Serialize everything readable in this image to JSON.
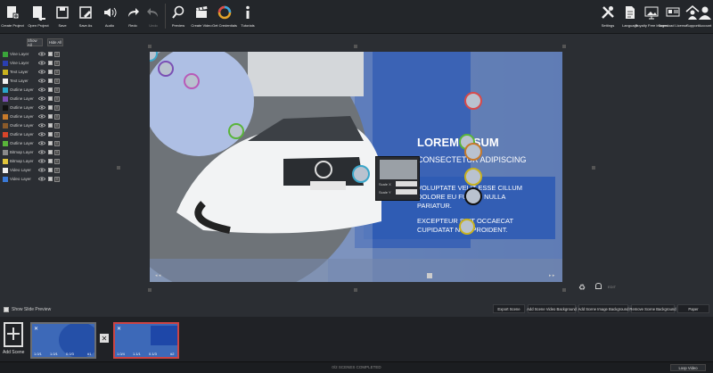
{
  "toolbar": {
    "left": [
      {
        "label": "Create Project",
        "icon": "create-project-icon"
      },
      {
        "label": "Open Project",
        "icon": "open-project-icon"
      },
      {
        "label": "Save",
        "icon": "save-icon"
      },
      {
        "label": "Save As",
        "icon": "save-as-icon"
      },
      {
        "label": "Audio",
        "icon": "audio-icon"
      },
      {
        "label": "Redo",
        "icon": "redo-icon"
      },
      {
        "label": "Undo",
        "icon": "undo-icon"
      },
      {
        "label": "Preview",
        "icon": "preview-icon"
      },
      {
        "label": "Create Video",
        "icon": "create-video-icon"
      },
      {
        "label": "Get Credentials",
        "icon": "credentials-icon"
      },
      {
        "label": "Tutorials",
        "icon": "tutorials-icon"
      }
    ],
    "right": [
      {
        "label": "Settings",
        "icon": "settings-icon"
      },
      {
        "label": "Language",
        "icon": "language-icon"
      },
      {
        "label": "Royalty Free Images",
        "icon": "royalty-free-images-icon"
      },
      {
        "label": "Download License",
        "icon": "download-license-icon"
      },
      {
        "label": "Support",
        "icon": "support-icon"
      },
      {
        "label": "Account",
        "icon": "account-icon"
      }
    ]
  },
  "layers": {
    "show_all": "Show All",
    "hide_all": "Hide All",
    "items": [
      {
        "name": "Vine Layer",
        "color": "#3aa53a"
      },
      {
        "name": "Vine Layer",
        "color": "#2a3fb0"
      },
      {
        "name": "Text Layer",
        "color": "#c9b21e"
      },
      {
        "name": "Text Layer",
        "color": "#f0f0f0"
      },
      {
        "name": "Outline Layer",
        "color": "#2aa6c9"
      },
      {
        "name": "Outline Layer",
        "color": "#7a4fb4"
      },
      {
        "name": "Outline Layer",
        "color": "#111111"
      },
      {
        "name": "Outline Layer",
        "color": "#c77a2a"
      },
      {
        "name": "Outline Layer",
        "color": "#8a5a2a"
      },
      {
        "name": "Outline Layer",
        "color": "#d8452a"
      },
      {
        "name": "Outline Layer",
        "color": "#59b43a"
      },
      {
        "name": "Bitmap Layer",
        "color": "#8a8a8a"
      },
      {
        "name": "Bitmap Layer",
        "color": "#e0c43a"
      },
      {
        "name": "Video Layer",
        "color": "#f0f0f0"
      },
      {
        "name": "Video Layer",
        "color": "#3a7ad8"
      }
    ]
  },
  "stage": {
    "title1": "LOREM IPSUM",
    "title2": "CONSECTETUR ADIPISCING",
    "para1a": "VOLUPTATE VELIT ESSE CILLUM",
    "para1b": "DOLORE EU FUGIAT NULLA",
    "para1c": "PARIATUR.",
    "para2a": "EXCEPTEUR SINT OCCAECAT",
    "para2b": "CUPIDATAT NON PROIDENT.",
    "popup_label1": "Scale X",
    "popup_label2": "Scale Y",
    "lock_label": "EDIT"
  },
  "bottom": {
    "show_slide_preview": "Show Slide Preview",
    "export_scene": "Export Scene",
    "add_video_bg": "Add Scene Video Background",
    "add_image_bg": "Add Scene Image Background",
    "remove_bg": "Remove Scene Background",
    "paper": "Paper"
  },
  "timeline": {
    "add_scene": "Add Scene",
    "scene1": {
      "a": "1.0/1",
      "b": "1.0/1",
      "c": "0.0/3",
      "d": "#1"
    },
    "scene2": {
      "a": "1.0/4",
      "b": "1.1/1",
      "c": "0.1/3",
      "d": "#2"
    }
  },
  "status": {
    "scenes_completed": "0/2 SCENES COMPLETED",
    "loop_video": "Loop Video"
  }
}
